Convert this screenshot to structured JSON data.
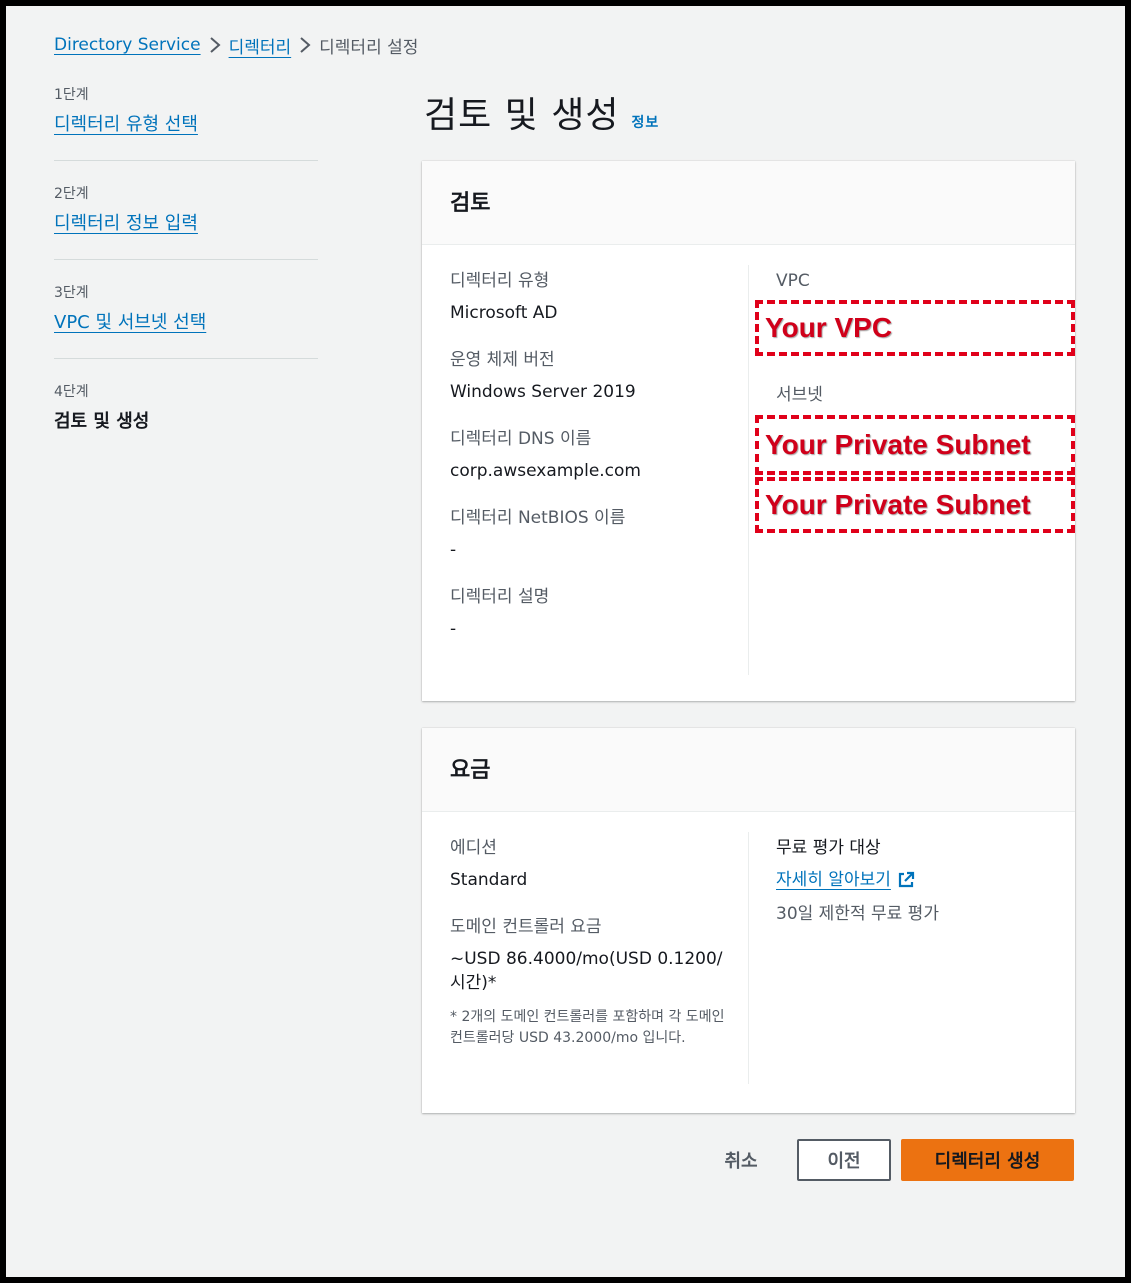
{
  "breadcrumb": {
    "items": [
      "Directory Service",
      "디렉터리"
    ],
    "current": "디렉터리 설정",
    "separator": "›"
  },
  "sidebar": {
    "steps": [
      {
        "num": "1단계",
        "title": "디렉터리 유형 선택"
      },
      {
        "num": "2단계",
        "title": "디렉터리 정보 입력"
      },
      {
        "num": "3단계",
        "title": "VPC 및 서브넷 선택"
      },
      {
        "num": "4단계",
        "title": "검토 및 생성"
      }
    ]
  },
  "page": {
    "title": "검토 및 생성",
    "info_link": "정보"
  },
  "review": {
    "header": "검토",
    "left": [
      {
        "label": "디렉터리 유형",
        "value": "Microsoft AD"
      },
      {
        "label": "운영 체제 버전",
        "value": "Windows Server 2019"
      },
      {
        "label": "디렉터리 DNS 이름",
        "value": "corp.awsexample.com"
      },
      {
        "label": "디렉터리 NetBIOS 이름",
        "value": "-"
      },
      {
        "label": "디렉터리 설명",
        "value": "-"
      }
    ],
    "right": {
      "vpc_label": "VPC",
      "vpc_value": "Your VPC",
      "subnet_label": "서브넷",
      "subnet_values": [
        "Your Private Subnet",
        "Your Private Subnet"
      ]
    }
  },
  "pricing": {
    "header": "요금",
    "edition_label": "에디션",
    "edition_value": "Standard",
    "dc_label": "도메인 컨트롤러 요금",
    "dc_value": "~USD 86.4000/mo(USD 0.1200/시간)*",
    "note": "* 2개의 도메인 컨트롤러를 포함하며 각 도메인 컨트롤러당 USD 43.2000/mo 입니다.",
    "free_trial_label": "무료 평가 대상",
    "learn_more": "자세히 알아보기",
    "trial_desc": "30일 제한적 무료 평가"
  },
  "footer": {
    "cancel": "취소",
    "previous": "이전",
    "create": "디렉터리 생성"
  },
  "colors": {
    "link": "#0073bb",
    "primary_button": "#ec7211",
    "annotation_red": "#e0001a"
  }
}
